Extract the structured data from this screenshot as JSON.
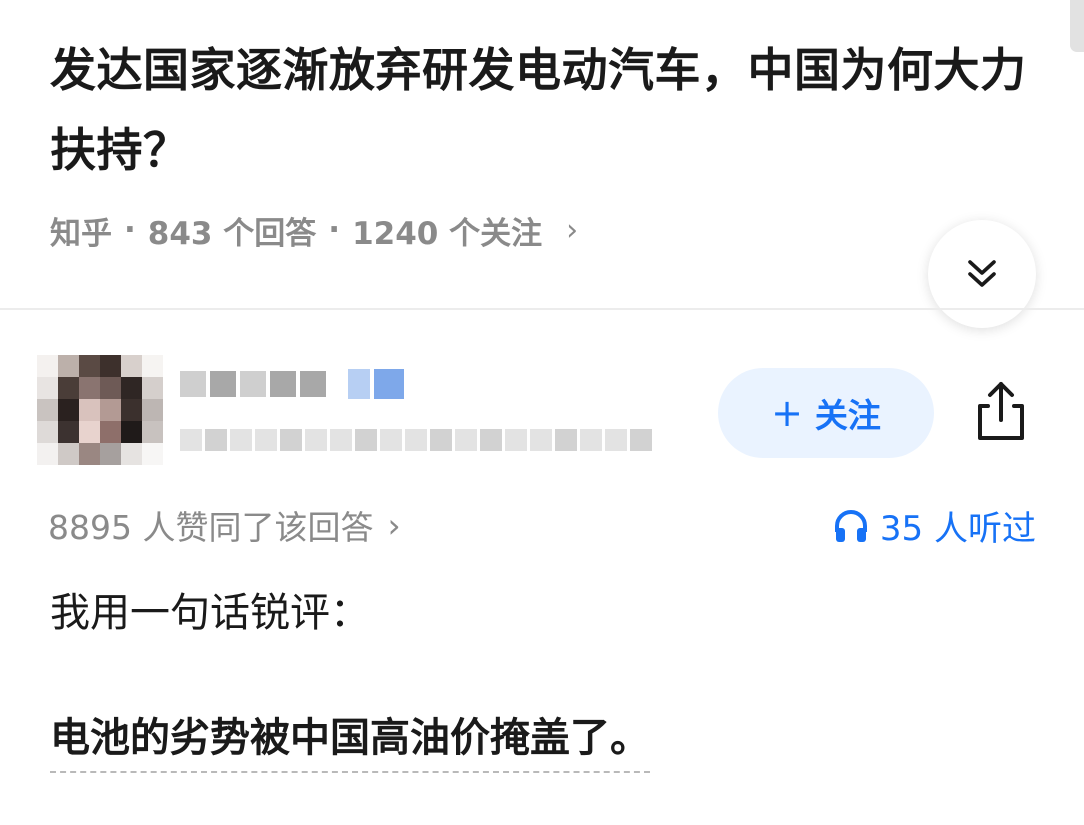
{
  "question": {
    "title": "发达国家逐渐放弃研发电动汽车，中国为何大力扶持？"
  },
  "meta": {
    "source": "知乎",
    "answers": "843 个回答",
    "followers": "1240 个关注",
    "separator": "·",
    "chevron": "›"
  },
  "author": {
    "follow_label": "关注",
    "follow_plus": "+"
  },
  "stats": {
    "upvotes": "8895 人赞同了该回答",
    "upvotes_chevron": "›",
    "listeners": "35 人听过"
  },
  "answer": {
    "paragraph_1": "我用一句话锐评：",
    "paragraph_2": "电池的劣势被中国高油价掩盖了。"
  },
  "colors": {
    "accent": "#1772f6",
    "follow_bg": "#eaf3ff",
    "meta_gray": "#8a8a8a"
  },
  "icons": [
    "chevron-double-down-icon",
    "share-icon",
    "headphones-icon",
    "plus-icon"
  ]
}
